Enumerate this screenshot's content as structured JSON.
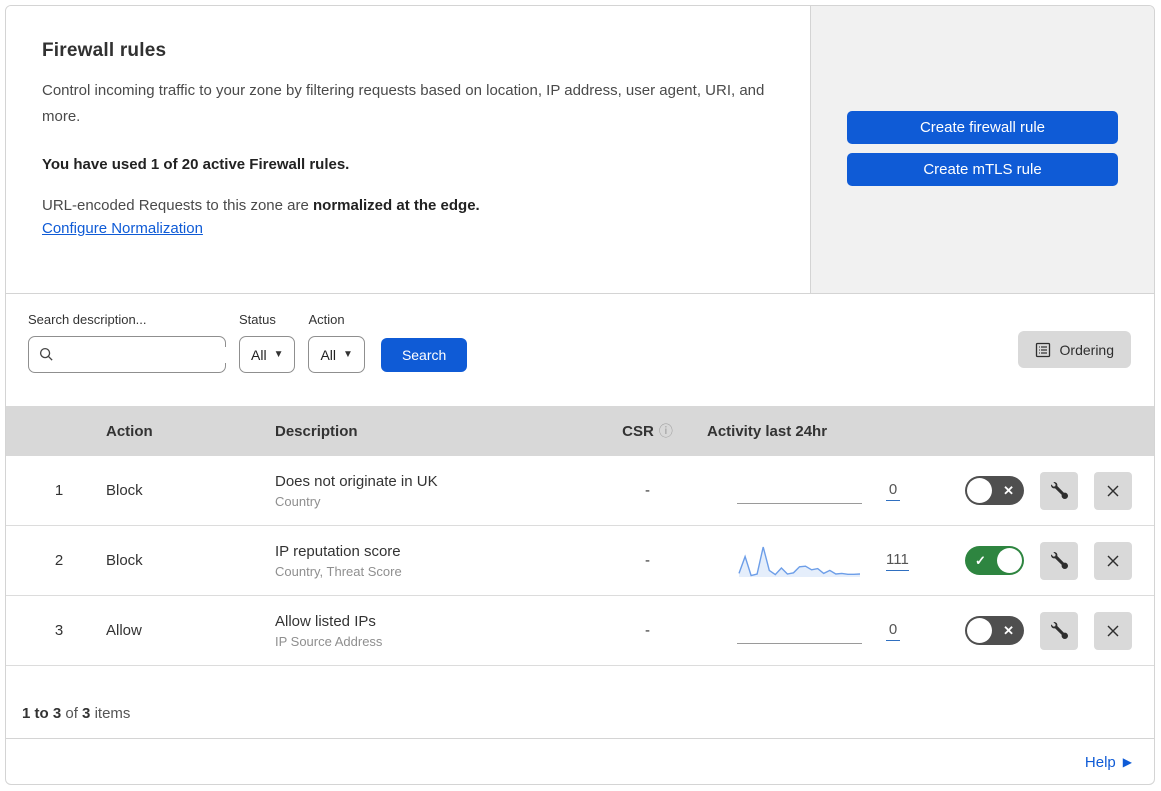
{
  "header": {
    "title": "Firewall rules",
    "description": "Control incoming traffic to your zone by filtering requests based on location, IP address, user agent, URI, and more.",
    "usage": "You have used 1 of 20 active Firewall rules.",
    "normalization_prefix": "URL-encoded Requests to this zone are ",
    "normalization_bold": "normalized at the edge.",
    "normalization_link": "Configure Normalization"
  },
  "actions_panel": {
    "create_firewall_rule_label": "Create firewall rule",
    "create_mtls_rule_label": "Create mTLS rule"
  },
  "filters": {
    "search_label": "Search description...",
    "search_value": "",
    "status_label": "Status",
    "status_value": "All",
    "action_label": "Action",
    "action_value": "All",
    "search_button_label": "Search",
    "ordering_button_label": "Ordering"
  },
  "table": {
    "headers": {
      "action": "Action",
      "description": "Description",
      "csr": "CSR",
      "activity": "Activity last 24hr"
    },
    "rows": [
      {
        "priority": "1",
        "action": "Block",
        "description": "Does not originate in UK",
        "fields": "Country",
        "csr": "-",
        "count": "0",
        "enabled": false
      },
      {
        "priority": "2",
        "action": "Block",
        "description": "IP reputation score",
        "fields": "Country, Threat Score",
        "csr": "-",
        "count": "111",
        "enabled": true
      },
      {
        "priority": "3",
        "action": "Allow",
        "description": "Allow listed IPs",
        "fields": "IP Source Address",
        "csr": "-",
        "count": "0",
        "enabled": false
      }
    ]
  },
  "footer": {
    "range": "1 to 3",
    "of_word": "of",
    "total": "3",
    "items_word": "items"
  },
  "help": {
    "label": "Help"
  },
  "colors": {
    "primary_blue": "#0f5bd6",
    "link_blue": "#0f5bd6",
    "toggle_on_green": "#2e8540",
    "toggle_off_gray": "#4f4f4f",
    "panel_gray": "#f1f1f1",
    "table_header_gray": "#d8d8d8",
    "button_gray": "#d9d9d9",
    "sparkline_blue": "#6d9ee8"
  },
  "chart_data": {
    "type": "line",
    "title": "Activity last 24hr sparkline (rule 2)",
    "xlabel": "time (last 24hr, unlabeled)",
    "ylabel": "requests (unlabeled)",
    "ylim": [
      0,
      100
    ],
    "grid": false,
    "legend": false,
    "series": [
      {
        "name": "rule-2-activity",
        "values": [
          12,
          68,
          5,
          10,
          100,
          22,
          8,
          30,
          10,
          14,
          34,
          36,
          24,
          28,
          12,
          22,
          10,
          12,
          9,
          9,
          10
        ]
      }
    ],
    "total_label": "111"
  }
}
